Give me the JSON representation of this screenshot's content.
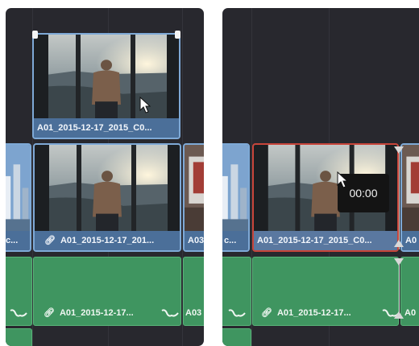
{
  "left_panel": {
    "lifted_clip_name": "A01_2015-12-17_2015_C0...",
    "track_prev_clip_label": "c...",
    "track_clip_name": "A01_2015-12-17_201...",
    "track_next_clip_label": "A03",
    "audio_clip_name": "A01_2015-12-17...",
    "audio_next_label": "A03"
  },
  "right_panel": {
    "track_prev_clip_label": "c...",
    "selected_clip_name": "A01_2015-12-17_2015_C0...",
    "track_next_clip_label": "A0",
    "timecode_tooltip": "00:00",
    "audio_clip_name": "A01_2015-12-17...",
    "audio_next_label": "A0"
  },
  "icons": {
    "link": "link-icon",
    "waveform": "audio-waveform-icon",
    "cursor": "mouse-pointer-icon",
    "trim_marker": "triangle-marker-icon"
  },
  "colors": {
    "background": "#28282e",
    "video_clip": "#4b6f99",
    "video_border": "#7ea9d6",
    "selected_border": "#c8453a",
    "audio_clip": "#3f9560"
  }
}
